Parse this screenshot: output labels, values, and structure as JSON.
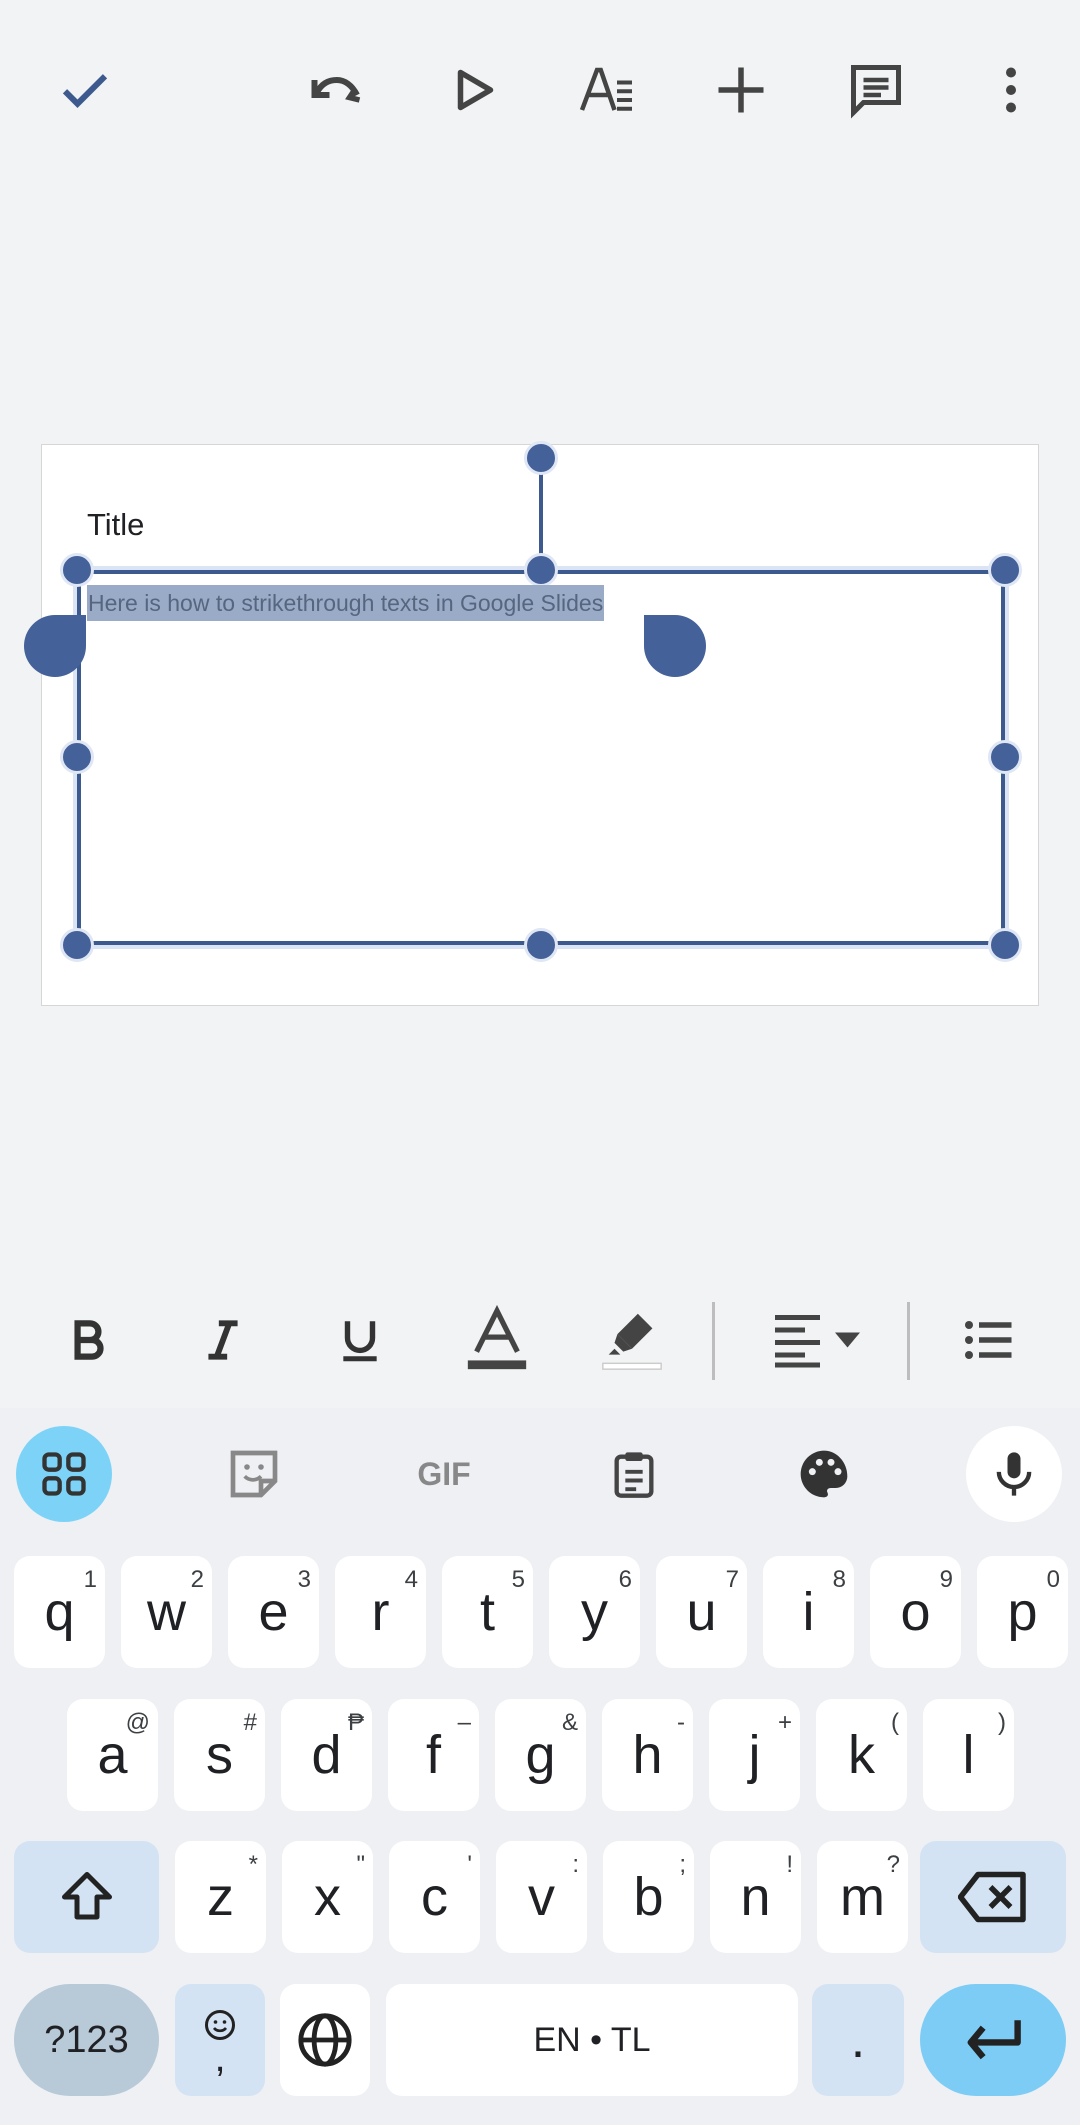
{
  "colors": {
    "accent": "#3d5a8f",
    "handle": "#45619a",
    "key_mod": "#d3e3f3",
    "enter": "#7dccf5",
    "grid_active": "#7dd3f7"
  },
  "toolbar": {
    "icons": [
      "check-icon",
      "undo-icon",
      "play-icon",
      "text-format-icon",
      "add-icon",
      "comment-icon",
      "more-vert-icon"
    ]
  },
  "slide": {
    "title": "Title",
    "body_text": "Here is how to strikethrough texts in Google Slides"
  },
  "format_bar": {
    "icons": [
      "bold-icon",
      "italic-icon",
      "underline-icon",
      "text-color-icon",
      "highlight-icon",
      "align-left-icon",
      "bulleted-list-icon"
    ]
  },
  "keyboard": {
    "toolbar_icons": [
      "apps-grid-icon",
      "sticker-icon",
      "gif-icon",
      "clipboard-icon",
      "palette-icon",
      "mic-icon"
    ],
    "gif_label": "GIF",
    "row1": [
      {
        "k": "q",
        "h": "1"
      },
      {
        "k": "w",
        "h": "2"
      },
      {
        "k": "e",
        "h": "3"
      },
      {
        "k": "r",
        "h": "4"
      },
      {
        "k": "t",
        "h": "5"
      },
      {
        "k": "y",
        "h": "6"
      },
      {
        "k": "u",
        "h": "7"
      },
      {
        "k": "i",
        "h": "8"
      },
      {
        "k": "o",
        "h": "9"
      },
      {
        "k": "p",
        "h": "0"
      }
    ],
    "row2": [
      {
        "k": "a",
        "h": "@"
      },
      {
        "k": "s",
        "h": "#"
      },
      {
        "k": "d",
        "h": "₱"
      },
      {
        "k": "f",
        "h": "–"
      },
      {
        "k": "g",
        "h": "&"
      },
      {
        "k": "h",
        "h": "-"
      },
      {
        "k": "j",
        "h": "+"
      },
      {
        "k": "k",
        "h": "("
      },
      {
        "k": "l",
        "h": ")"
      }
    ],
    "row3": [
      {
        "k": "z",
        "h": "*"
      },
      {
        "k": "x",
        "h": "\""
      },
      {
        "k": "c",
        "h": "'"
      },
      {
        "k": "v",
        "h": ":"
      },
      {
        "k": "b",
        "h": ";"
      },
      {
        "k": "n",
        "h": "!"
      },
      {
        "k": "m",
        "h": "?"
      }
    ],
    "symbols_label": "?123",
    "emoji_comma": ",",
    "space_label": "EN • TL",
    "period_label": "."
  }
}
